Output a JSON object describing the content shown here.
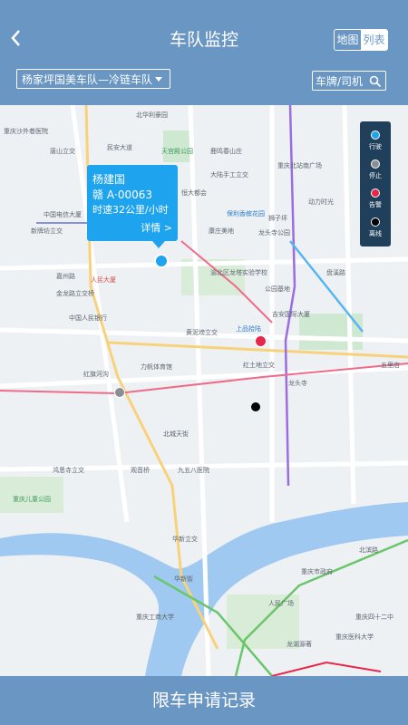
{
  "header": {
    "title": "车队监控",
    "view_toggle": {
      "map_label": "地图",
      "list_label": "列表"
    },
    "fleet_select": "杨家坪国美车队—冷链车队",
    "search_label": "车牌/司机"
  },
  "legend": {
    "items": [
      {
        "label": "行驶",
        "color": "#1ea3ef"
      },
      {
        "label": "停止",
        "color": "#8a8f95"
      },
      {
        "label": "告警",
        "color": "#e8254b"
      },
      {
        "label": "离线",
        "color": "#000000"
      }
    ]
  },
  "popup": {
    "driver": "杨建国",
    "plate": "赣 A·00063",
    "speed": "时速32公里/小时",
    "detail": "详情 >"
  },
  "map_labels": [
    "北华利豪园",
    "重庆沙外巷医院",
    "唐山立交",
    "民安大道",
    "天宫殿公园",
    "鹿鸣春山庄",
    "大陆手工立交",
    "恒大都会",
    "保利香槟花园",
    "重庆北站南广场",
    "动力时光",
    "狮子坪",
    "康庄美地",
    "龙头寺公园",
    "中国电信大厦",
    "新牌坊立交",
    "嘉州路",
    "人民大厦",
    "盘溪路",
    "金龙路立交桥",
    "中国人民银行",
    "渝北区龙塔实验学校",
    "公园基地",
    "黄泥塝立交",
    "上品拾陆",
    "吉安国际大厦",
    "红土地立交",
    "力帆体育馆",
    "红旗河沟",
    "观音桥",
    "鸿恩寺立交",
    "九五八医院",
    "龙头寺",
    "北城天街",
    "重庆儿童公园",
    "华新立交",
    "华新街",
    "重庆工商大学",
    "重庆市政府",
    "人民广场",
    "龙湖源著",
    "重庆四十二中",
    "重庆医科大学",
    "北滨路",
    "五里店"
  ],
  "footer": {
    "label": "限车申请记录"
  }
}
